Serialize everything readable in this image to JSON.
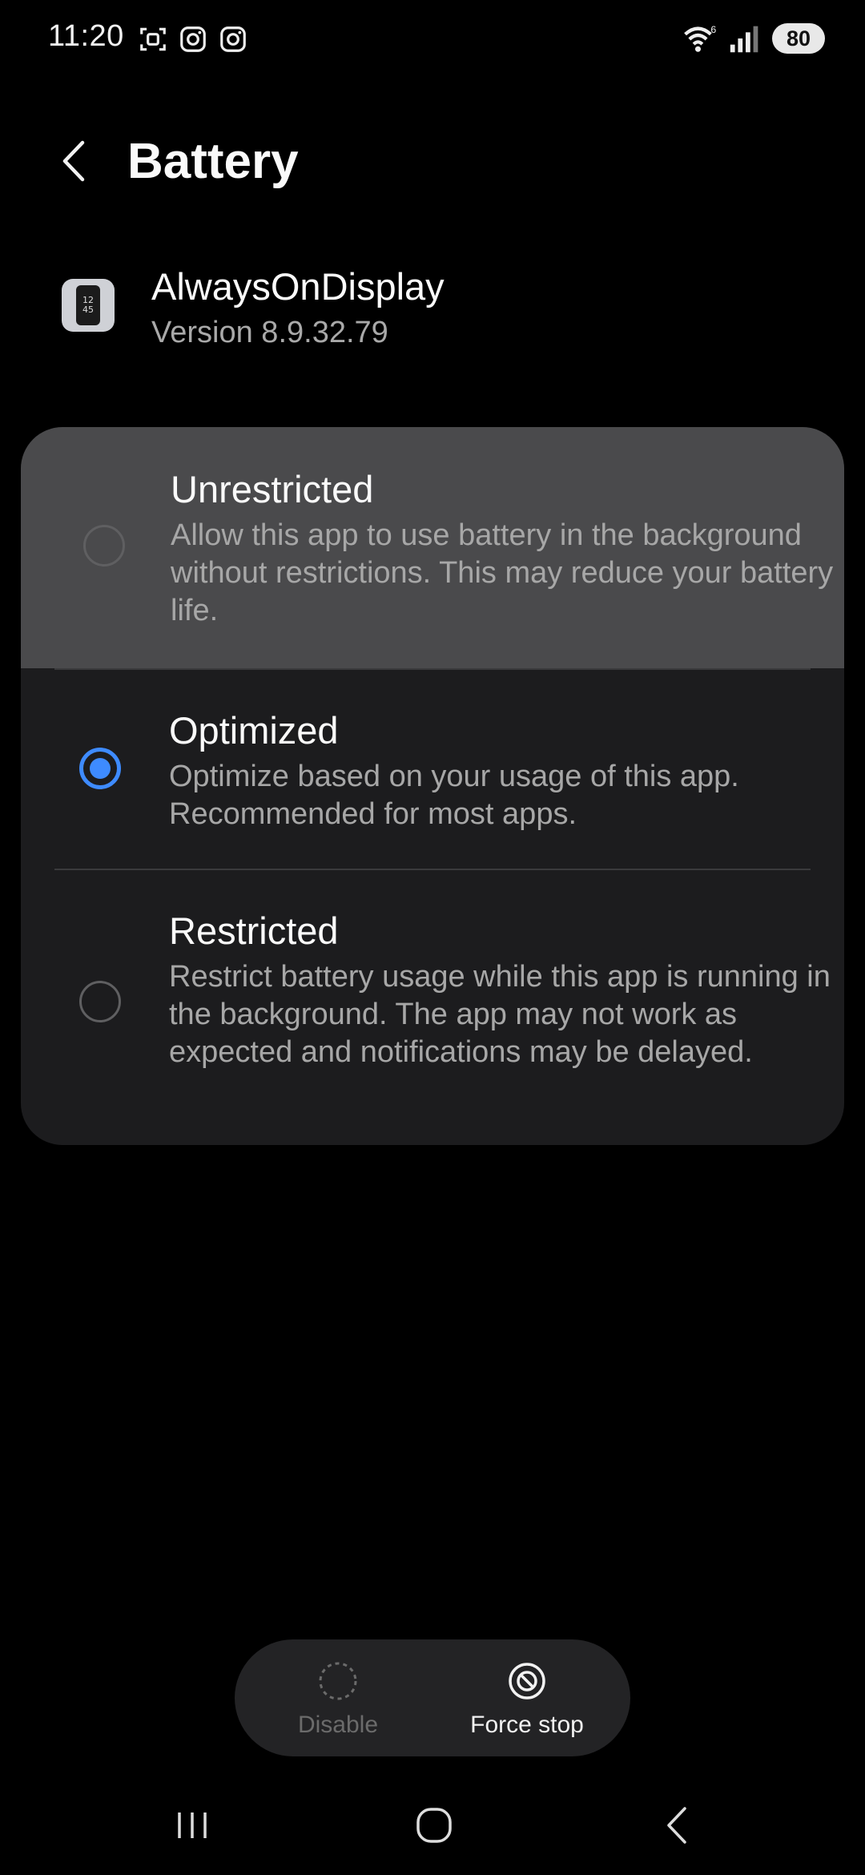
{
  "status_bar": {
    "time": "11:20",
    "icons": [
      "screen-capture-icon",
      "instagram-icon",
      "instagram-icon"
    ],
    "wifi_icon": "wifi-icon",
    "signal_icon": "cellular-signal-icon",
    "battery_level": "80"
  },
  "header": {
    "back_icon": "chevron-left-icon",
    "title": "Battery"
  },
  "app": {
    "icon_text_line1": "12",
    "icon_text_line2": "45",
    "name": "AlwaysOnDisplay",
    "version": "Version 8.9.32.79"
  },
  "options": [
    {
      "title": "Unrestricted",
      "description": "Allow this app to use battery in the background without restrictions. This may reduce your battery life.",
      "selected": false
    },
    {
      "title": "Optimized",
      "description": "Optimize based on your usage of this app. Recommended for most apps.",
      "selected": true
    },
    {
      "title": "Restricted",
      "description": "Restrict battery usage while this app is running in the background. The app may not work as expected and notifications may be delayed.",
      "selected": false
    }
  ],
  "actions": {
    "disable_label": "Disable",
    "force_stop_label": "Force stop"
  },
  "nav": {
    "recents_icon": "recents-icon",
    "home_icon": "home-icon",
    "back_icon": "back-icon"
  },
  "colors": {
    "accent": "#3e8bff",
    "background": "#000000",
    "card": "#1c1c1e",
    "pressed": "#4a4a4c"
  }
}
